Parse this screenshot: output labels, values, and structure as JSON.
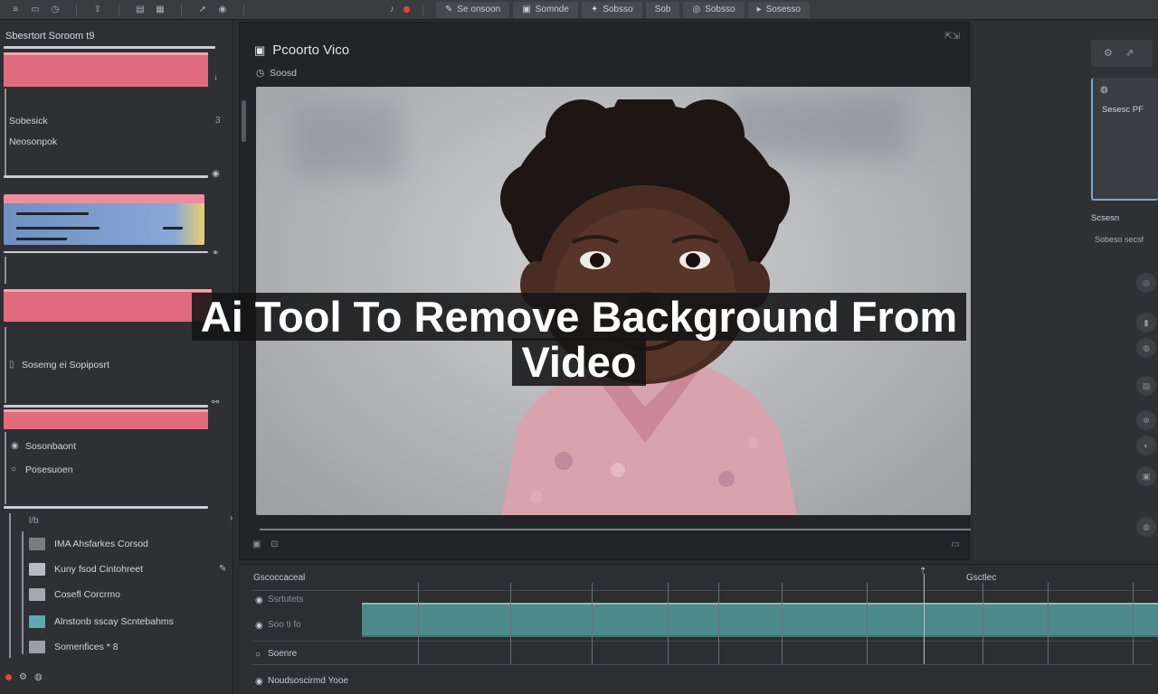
{
  "toolbar": {
    "tabs": [
      "Se onsoon",
      "Somnde",
      "Sobsso",
      "Sob",
      "Sobsso",
      "Sosesso"
    ]
  },
  "left_panel": {
    "title": "Sbesrtort Soroom  t9",
    "item_1": "Sobesick",
    "item_2": "Neosonpok",
    "item_3": "Sosemg ei Sopiposrt",
    "item_4": "Sosonbaont",
    "item_5": "Posesuoen",
    "media": [
      {
        "label": "IMA Ahsfarkes Corsod",
        "color": "#7a7d82"
      },
      {
        "label": "Kuny fsod Cintohreet",
        "color": "#b8bcc2"
      },
      {
        "label": "Cosefl Corcrmo",
        "color": "#a6aab0"
      },
      {
        "label": "Alnstonb sscay Scntebahms",
        "color": "#5fa8b0"
      },
      {
        "label": "Somenfices * 8",
        "color": "#9ca0a6"
      }
    ]
  },
  "preview": {
    "title": "Pcoorto Vico",
    "subtitle": "Soosd"
  },
  "timeline": {
    "header": "Gscoccaceal",
    "right_label": "Gsctlec",
    "row_1": "Ssrtutets",
    "row_2": "Soo ti fo",
    "row_3": "Soenre",
    "row_4": "Noudsoscirmd Yooe"
  },
  "right_panel": {
    "label_1": "Sesesc PF",
    "label_2": "Scsesn",
    "label_3": "Sobeso secsf"
  },
  "overlay": {
    "line_1": "Ai Tool To Remove Background From",
    "line_2": "Video"
  },
  "colors": {
    "accent_pink": "#e06b7c",
    "accent_teal": "#4b8a88",
    "record_red": "#e0473c"
  }
}
